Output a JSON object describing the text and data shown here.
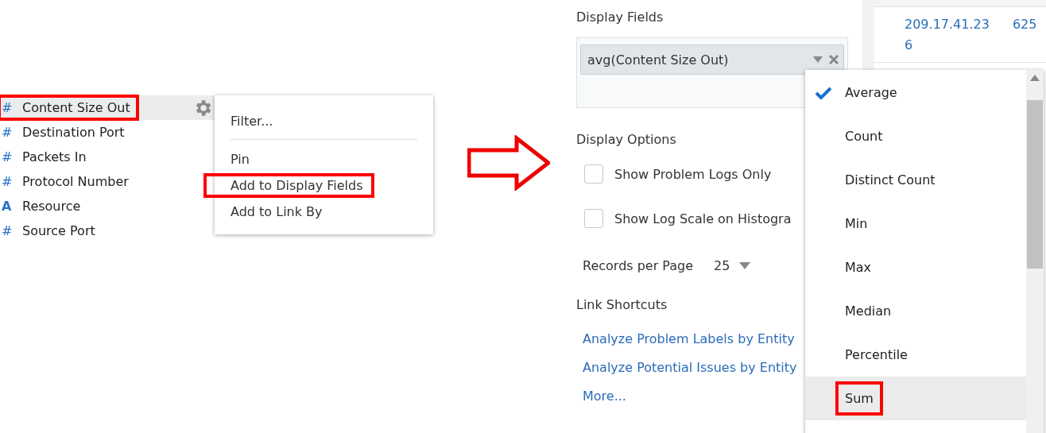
{
  "fields_list": [
    {
      "kind": "number",
      "type_glyph": "#",
      "label": "Content Size Out",
      "hovered": true,
      "highlighted": true
    },
    {
      "kind": "number",
      "type_glyph": "#",
      "label": "Destination Port",
      "hovered": false,
      "highlighted": false
    },
    {
      "kind": "number",
      "type_glyph": "#",
      "label": "Packets In",
      "hovered": false,
      "highlighted": false
    },
    {
      "kind": "number",
      "type_glyph": "#",
      "label": "Protocol Number",
      "hovered": false,
      "highlighted": false
    },
    {
      "kind": "text",
      "type_glyph": "A",
      "label": "Resource",
      "hovered": false,
      "highlighted": false
    },
    {
      "kind": "number",
      "type_glyph": "#",
      "label": "Source Port",
      "hovered": false,
      "highlighted": false
    }
  ],
  "context_menu": [
    {
      "kind": "item",
      "label": "Filter...",
      "highlighted": false
    },
    {
      "kind": "divider"
    },
    {
      "kind": "item",
      "label": "Pin",
      "highlighted": false
    },
    {
      "kind": "item",
      "label": "Add to Display Fields",
      "highlighted": true
    },
    {
      "kind": "item",
      "label": "Add to Link By",
      "highlighted": false
    }
  ],
  "settings": {
    "display_fields_title": "Display Fields",
    "display_field_chip": "avg(Content Size Out)",
    "display_options_title": "Display Options",
    "options": [
      {
        "label": "Show Problem Logs Only",
        "checked": false
      },
      {
        "label": "Show Log Scale on Histogra",
        "checked": false
      }
    ],
    "records_per_page_label": "Records per Page",
    "records_per_page_value": "25",
    "link_shortcuts_title": "Link Shortcuts",
    "links": [
      "Analyze Problem Labels by Entity",
      "Analyze Potential Issues by Entity",
      "More..."
    ]
  },
  "table": {
    "rows": [
      {
        "column_1": "209.17.41.23 6",
        "column_2": "625"
      }
    ]
  },
  "aggregate_menu": [
    {
      "label": "Average",
      "selected": true,
      "hovered": false,
      "highlighted": false
    },
    {
      "label": "Count",
      "selected": false,
      "hovered": false,
      "highlighted": false
    },
    {
      "label": "Distinct Count",
      "selected": false,
      "hovered": false,
      "highlighted": false
    },
    {
      "label": "Min",
      "selected": false,
      "hovered": false,
      "highlighted": false
    },
    {
      "label": "Max",
      "selected": false,
      "hovered": false,
      "highlighted": false
    },
    {
      "label": "Median",
      "selected": false,
      "hovered": false,
      "highlighted": false
    },
    {
      "label": "Percentile",
      "selected": false,
      "hovered": false,
      "highlighted": false
    },
    {
      "label": "Sum",
      "selected": false,
      "hovered": true,
      "highlighted": true
    }
  ]
}
